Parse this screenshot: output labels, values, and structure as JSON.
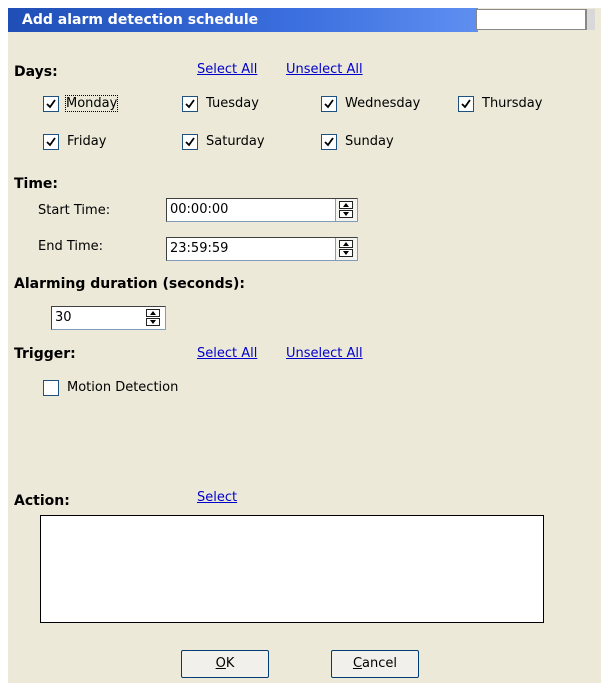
{
  "title": "Add alarm detection schedule",
  "days": {
    "label": "Days:",
    "select_all": "Select All",
    "unselect_all": "Unselect All",
    "items": [
      {
        "label": "Monday",
        "checked": true
      },
      {
        "label": "Tuesday",
        "checked": true
      },
      {
        "label": "Wednesday",
        "checked": true
      },
      {
        "label": "Thursday",
        "checked": true
      },
      {
        "label": "Friday",
        "checked": true
      },
      {
        "label": "Saturday",
        "checked": true
      },
      {
        "label": "Sunday",
        "checked": true
      }
    ]
  },
  "time": {
    "label": "Time:",
    "start_label": "Start Time:",
    "start_value": "00:00:00",
    "end_label": "End Time:",
    "end_value": "23:59:59"
  },
  "duration": {
    "label": "Alarming duration (seconds):",
    "value": "30"
  },
  "trigger": {
    "label": "Trigger:",
    "select_all": "Select All",
    "unselect_all": "Unselect All",
    "items": [
      {
        "label": "Motion Detection",
        "checked": false
      }
    ]
  },
  "action": {
    "label": "Action:",
    "select": "Select"
  },
  "buttons": {
    "ok_mnemonic": "O",
    "ok_rest": "K",
    "cancel_mnemonic": "C",
    "cancel_rest": "ancel"
  }
}
